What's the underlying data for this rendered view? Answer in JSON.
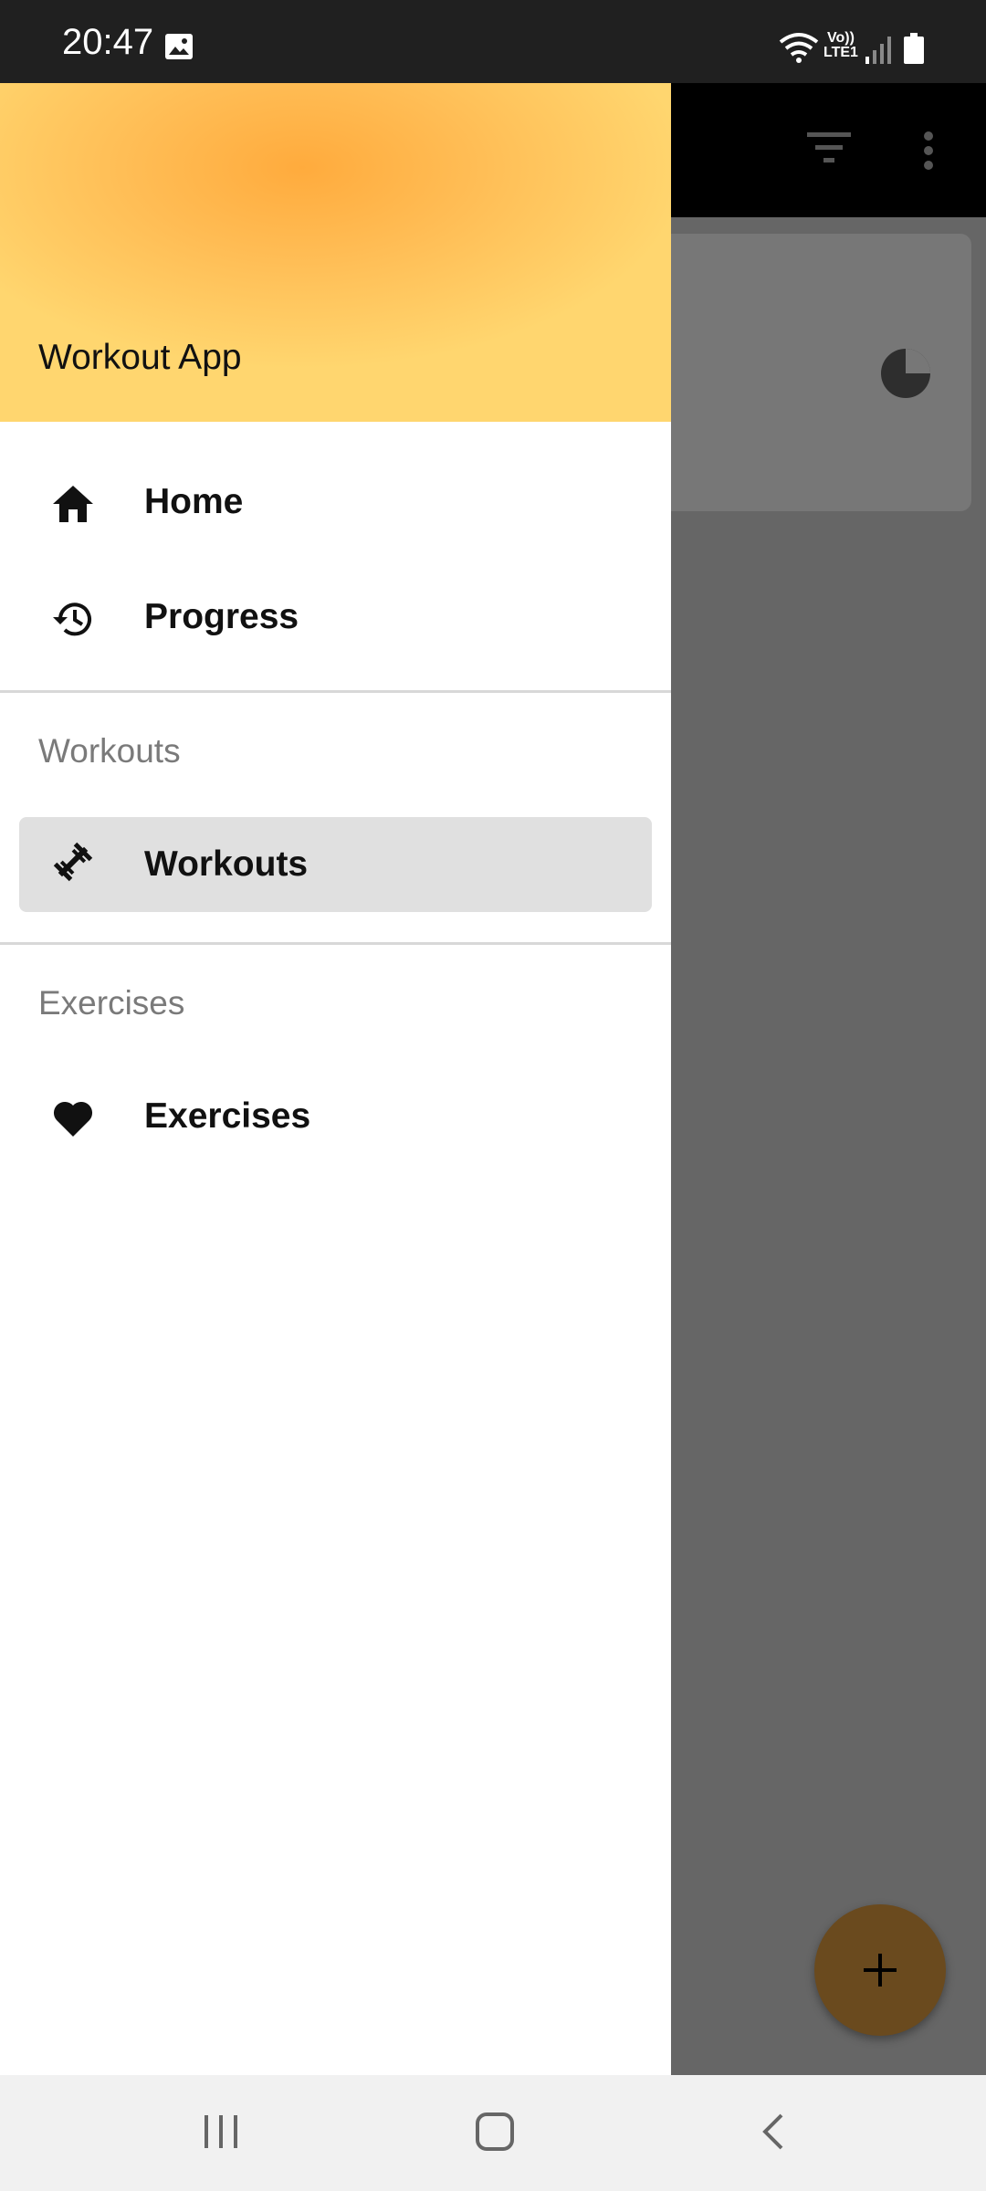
{
  "status_bar": {
    "time": "20:47",
    "lte_top": "Vo))",
    "lte_bottom": "LTE1",
    "icons": [
      "gallery-icon",
      "wifi-icon",
      "lte-icon",
      "signal-icon",
      "battery-icon"
    ]
  },
  "drawer": {
    "header_title": "Workout App",
    "items": [
      {
        "label": "Home",
        "icon": "home-icon"
      },
      {
        "label": "Progress",
        "icon": "history-icon"
      }
    ],
    "sections": [
      {
        "header": "Workouts",
        "item": {
          "label": "Workouts",
          "icon": "dumbbell-icon",
          "selected": true
        }
      },
      {
        "header": "Exercises",
        "item": {
          "label": "Exercises",
          "icon": "heart-icon",
          "selected": false
        }
      }
    ]
  },
  "background": {
    "toolbar_icons": [
      "filter-icon",
      "more-vert-icon"
    ],
    "fab_icon": "plus-icon"
  },
  "colors": {
    "header_gradient_center": "#ffab3d",
    "header_gradient_edge": "#ffd66f",
    "selected_item": "#e0e0e0",
    "scrim": "#666666",
    "fab": "#6a4a1e"
  }
}
